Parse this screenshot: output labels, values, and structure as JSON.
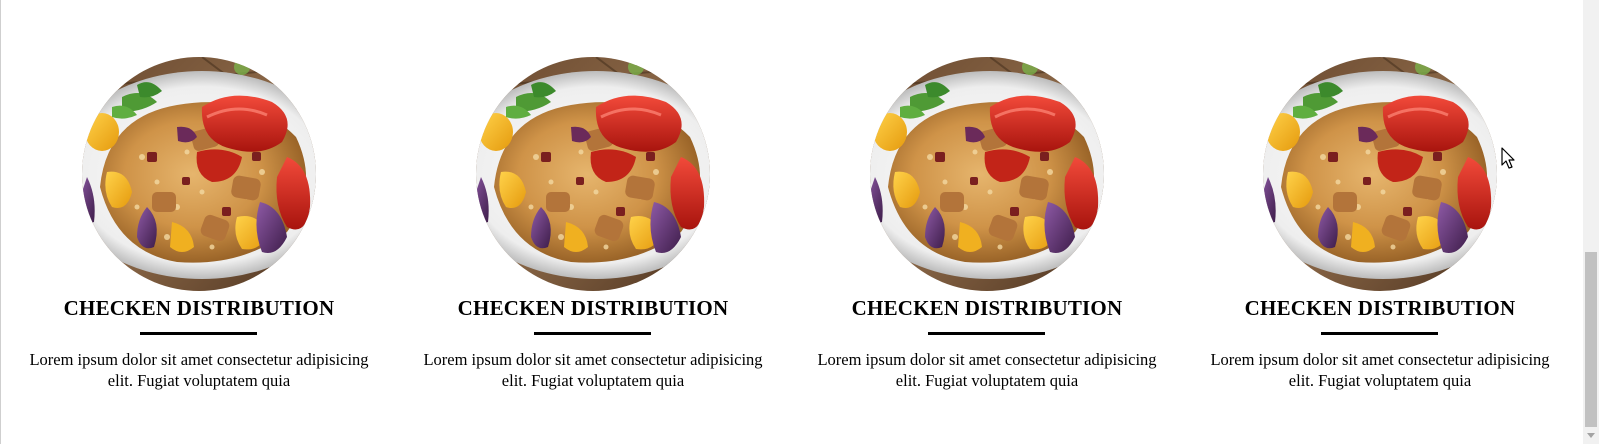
{
  "cards": [
    {
      "title": "CHECKEN DISTRIBUTION",
      "description": "Lorem ipsum dolor sit amet consectetur adipisicing elit. Fugiat voluptatem quia",
      "image": "chicken-rice-dish-image"
    },
    {
      "title": "CHECKEN DISTRIBUTION",
      "description": "Lorem ipsum dolor sit amet consectetur adipisicing elit. Fugiat voluptatem quia",
      "image": "chicken-rice-dish-image"
    },
    {
      "title": "CHECKEN DISTRIBUTION",
      "description": "Lorem ipsum dolor sit amet consectetur adipisicing elit. Fugiat voluptatem quia",
      "image": "chicken-rice-dish-image"
    },
    {
      "title": "CHECKEN DISTRIBUTION",
      "description": "Lorem ipsum dolor sit amet consectetur adipisicing elit. Fugiat voluptatem quia",
      "image": "chicken-rice-dish-image"
    }
  ],
  "colors": {
    "background": "#ffffff",
    "text": "#000000",
    "underline": "#000000",
    "scrollbar_track": "#f1f1f1",
    "scrollbar_thumb": "#c1c1c1"
  },
  "scrollbar": {
    "scroll_position": 1.0
  },
  "cursor": {
    "icon": "arrow-pointer-icon"
  }
}
